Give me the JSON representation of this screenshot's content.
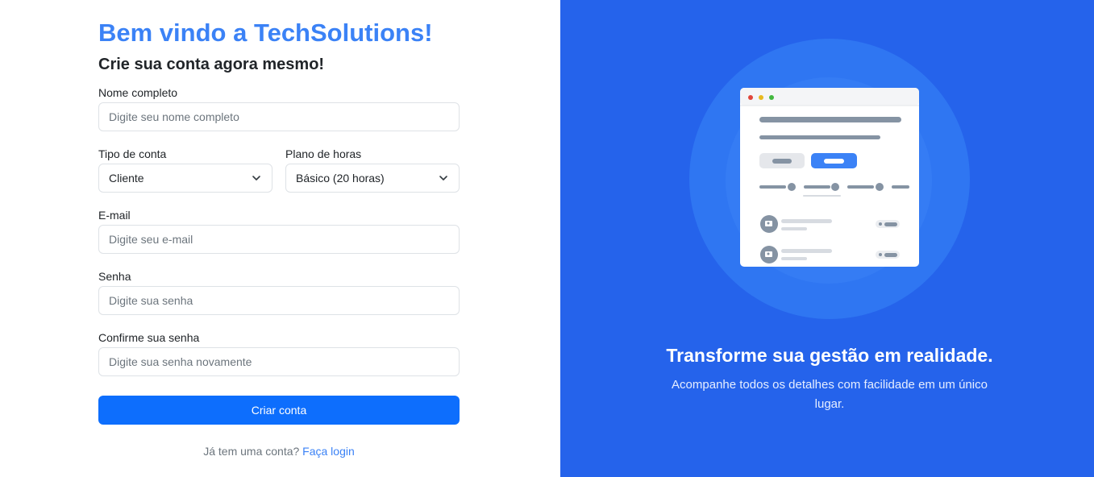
{
  "header": {
    "welcome_prefix": "Bem vindo a ",
    "brand": "TechSolutions!",
    "subtitle": "Crie sua conta agora mesmo!"
  },
  "form": {
    "name_label": "Nome completo",
    "name_placeholder": "Digite seu nome completo",
    "account_type_label": "Tipo de conta",
    "account_type_value": "Cliente",
    "plan_label": "Plano de horas",
    "plan_value": "Básico (20 horas)",
    "email_label": "E-mail",
    "email_placeholder": "Digite seu e-mail",
    "password_label": "Senha",
    "password_placeholder": "Digite sua senha",
    "confirm_label": "Confirme sua senha",
    "confirm_placeholder": "Digite sua senha novamente",
    "submit_label": "Criar conta",
    "footer_text": "Já tem uma conta?",
    "login_link": "Faça login"
  },
  "hero": {
    "title": "Transforme sua gestão em realidade.",
    "text": "Acompanhe todos os detalhes com facilidade em um único lugar."
  },
  "colors": {
    "brand": "#3b82f6",
    "primary_button": "#0d6efd",
    "hero_background": "#2563eb"
  },
  "icons": [
    "chevron-down-icon",
    "dashboard-illustration"
  ]
}
